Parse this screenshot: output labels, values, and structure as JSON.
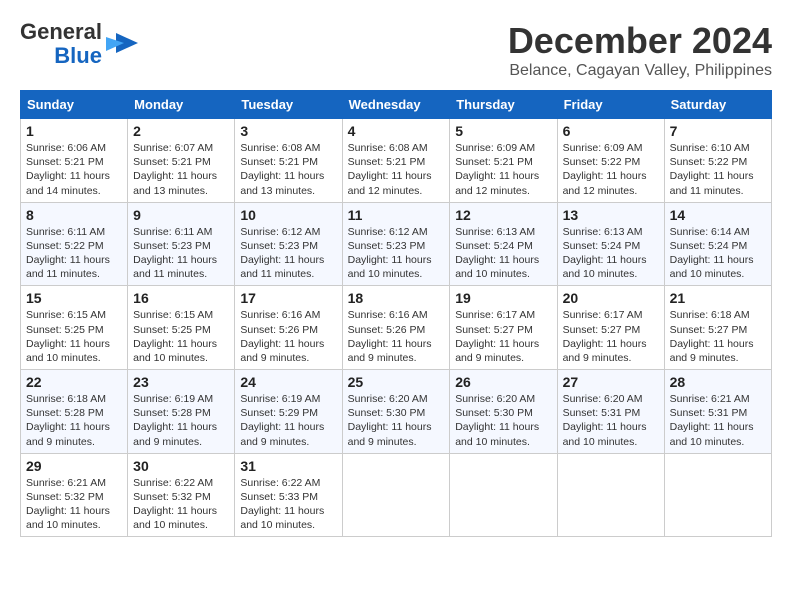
{
  "logo": {
    "line1": "General",
    "line2": "Blue"
  },
  "title": "December 2024",
  "subtitle": "Belance, Cagayan Valley, Philippines",
  "headers": [
    "Sunday",
    "Monday",
    "Tuesday",
    "Wednesday",
    "Thursday",
    "Friday",
    "Saturday"
  ],
  "weeks": [
    [
      {
        "day": "1",
        "sunrise": "Sunrise: 6:06 AM",
        "sunset": "Sunset: 5:21 PM",
        "daylight": "Daylight: 11 hours and 14 minutes."
      },
      {
        "day": "2",
        "sunrise": "Sunrise: 6:07 AM",
        "sunset": "Sunset: 5:21 PM",
        "daylight": "Daylight: 11 hours and 13 minutes."
      },
      {
        "day": "3",
        "sunrise": "Sunrise: 6:08 AM",
        "sunset": "Sunset: 5:21 PM",
        "daylight": "Daylight: 11 hours and 13 minutes."
      },
      {
        "day": "4",
        "sunrise": "Sunrise: 6:08 AM",
        "sunset": "Sunset: 5:21 PM",
        "daylight": "Daylight: 11 hours and 12 minutes."
      },
      {
        "day": "5",
        "sunrise": "Sunrise: 6:09 AM",
        "sunset": "Sunset: 5:21 PM",
        "daylight": "Daylight: 11 hours and 12 minutes."
      },
      {
        "day": "6",
        "sunrise": "Sunrise: 6:09 AM",
        "sunset": "Sunset: 5:22 PM",
        "daylight": "Daylight: 11 hours and 12 minutes."
      },
      {
        "day": "7",
        "sunrise": "Sunrise: 6:10 AM",
        "sunset": "Sunset: 5:22 PM",
        "daylight": "Daylight: 11 hours and 11 minutes."
      }
    ],
    [
      {
        "day": "8",
        "sunrise": "Sunrise: 6:11 AM",
        "sunset": "Sunset: 5:22 PM",
        "daylight": "Daylight: 11 hours and 11 minutes."
      },
      {
        "day": "9",
        "sunrise": "Sunrise: 6:11 AM",
        "sunset": "Sunset: 5:23 PM",
        "daylight": "Daylight: 11 hours and 11 minutes."
      },
      {
        "day": "10",
        "sunrise": "Sunrise: 6:12 AM",
        "sunset": "Sunset: 5:23 PM",
        "daylight": "Daylight: 11 hours and 11 minutes."
      },
      {
        "day": "11",
        "sunrise": "Sunrise: 6:12 AM",
        "sunset": "Sunset: 5:23 PM",
        "daylight": "Daylight: 11 hours and 10 minutes."
      },
      {
        "day": "12",
        "sunrise": "Sunrise: 6:13 AM",
        "sunset": "Sunset: 5:24 PM",
        "daylight": "Daylight: 11 hours and 10 minutes."
      },
      {
        "day": "13",
        "sunrise": "Sunrise: 6:13 AM",
        "sunset": "Sunset: 5:24 PM",
        "daylight": "Daylight: 11 hours and 10 minutes."
      },
      {
        "day": "14",
        "sunrise": "Sunrise: 6:14 AM",
        "sunset": "Sunset: 5:24 PM",
        "daylight": "Daylight: 11 hours and 10 minutes."
      }
    ],
    [
      {
        "day": "15",
        "sunrise": "Sunrise: 6:15 AM",
        "sunset": "Sunset: 5:25 PM",
        "daylight": "Daylight: 11 hours and 10 minutes."
      },
      {
        "day": "16",
        "sunrise": "Sunrise: 6:15 AM",
        "sunset": "Sunset: 5:25 PM",
        "daylight": "Daylight: 11 hours and 10 minutes."
      },
      {
        "day": "17",
        "sunrise": "Sunrise: 6:16 AM",
        "sunset": "Sunset: 5:26 PM",
        "daylight": "Daylight: 11 hours and 9 minutes."
      },
      {
        "day": "18",
        "sunrise": "Sunrise: 6:16 AM",
        "sunset": "Sunset: 5:26 PM",
        "daylight": "Daylight: 11 hours and 9 minutes."
      },
      {
        "day": "19",
        "sunrise": "Sunrise: 6:17 AM",
        "sunset": "Sunset: 5:27 PM",
        "daylight": "Daylight: 11 hours and 9 minutes."
      },
      {
        "day": "20",
        "sunrise": "Sunrise: 6:17 AM",
        "sunset": "Sunset: 5:27 PM",
        "daylight": "Daylight: 11 hours and 9 minutes."
      },
      {
        "day": "21",
        "sunrise": "Sunrise: 6:18 AM",
        "sunset": "Sunset: 5:27 PM",
        "daylight": "Daylight: 11 hours and 9 minutes."
      }
    ],
    [
      {
        "day": "22",
        "sunrise": "Sunrise: 6:18 AM",
        "sunset": "Sunset: 5:28 PM",
        "daylight": "Daylight: 11 hours and 9 minutes."
      },
      {
        "day": "23",
        "sunrise": "Sunrise: 6:19 AM",
        "sunset": "Sunset: 5:28 PM",
        "daylight": "Daylight: 11 hours and 9 minutes."
      },
      {
        "day": "24",
        "sunrise": "Sunrise: 6:19 AM",
        "sunset": "Sunset: 5:29 PM",
        "daylight": "Daylight: 11 hours and 9 minutes."
      },
      {
        "day": "25",
        "sunrise": "Sunrise: 6:20 AM",
        "sunset": "Sunset: 5:30 PM",
        "daylight": "Daylight: 11 hours and 9 minutes."
      },
      {
        "day": "26",
        "sunrise": "Sunrise: 6:20 AM",
        "sunset": "Sunset: 5:30 PM",
        "daylight": "Daylight: 11 hours and 10 minutes."
      },
      {
        "day": "27",
        "sunrise": "Sunrise: 6:20 AM",
        "sunset": "Sunset: 5:31 PM",
        "daylight": "Daylight: 11 hours and 10 minutes."
      },
      {
        "day": "28",
        "sunrise": "Sunrise: 6:21 AM",
        "sunset": "Sunset: 5:31 PM",
        "daylight": "Daylight: 11 hours and 10 minutes."
      }
    ],
    [
      {
        "day": "29",
        "sunrise": "Sunrise: 6:21 AM",
        "sunset": "Sunset: 5:32 PM",
        "daylight": "Daylight: 11 hours and 10 minutes."
      },
      {
        "day": "30",
        "sunrise": "Sunrise: 6:22 AM",
        "sunset": "Sunset: 5:32 PM",
        "daylight": "Daylight: 11 hours and 10 minutes."
      },
      {
        "day": "31",
        "sunrise": "Sunrise: 6:22 AM",
        "sunset": "Sunset: 5:33 PM",
        "daylight": "Daylight: 11 hours and 10 minutes."
      },
      null,
      null,
      null,
      null
    ]
  ]
}
